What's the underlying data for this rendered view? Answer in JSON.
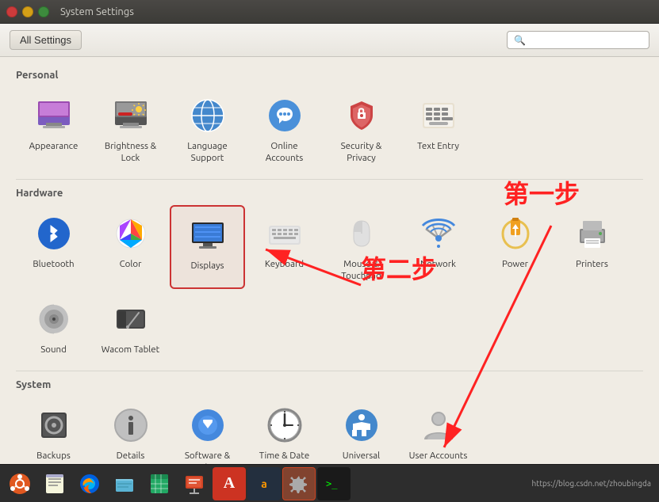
{
  "titlebar": {
    "title": "System Settings"
  },
  "toolbar": {
    "all_settings_label": "All Settings",
    "search_placeholder": ""
  },
  "sections": [
    {
      "name": "Personal",
      "items": [
        {
          "id": "appearance",
          "label": "Appearance",
          "icon": "appearance"
        },
        {
          "id": "brightness-lock",
          "label": "Brightness &\nLock",
          "icon": "brightness"
        },
        {
          "id": "language-support",
          "label": "Language\nSupport",
          "icon": "language"
        },
        {
          "id": "online-accounts",
          "label": "Online\nAccounts",
          "icon": "online-accounts"
        },
        {
          "id": "security-privacy",
          "label": "Security &\nPrivacy",
          "icon": "security"
        },
        {
          "id": "text-entry",
          "label": "Text Entry",
          "icon": "text-entry"
        }
      ]
    },
    {
      "name": "Hardware",
      "items": [
        {
          "id": "bluetooth",
          "label": "Bluetooth",
          "icon": "bluetooth"
        },
        {
          "id": "color",
          "label": "Color",
          "icon": "color"
        },
        {
          "id": "displays",
          "label": "Displays",
          "icon": "displays",
          "selected": true
        },
        {
          "id": "keyboard",
          "label": "Keyboard",
          "icon": "keyboard"
        },
        {
          "id": "mouse-touchpad",
          "label": "Mouse &\nTouchpad",
          "icon": "mouse"
        },
        {
          "id": "network",
          "label": "Network",
          "icon": "network"
        },
        {
          "id": "power",
          "label": "Power",
          "icon": "power"
        },
        {
          "id": "printers",
          "label": "Printers",
          "icon": "printers"
        },
        {
          "id": "sound",
          "label": "Sound",
          "icon": "sound"
        },
        {
          "id": "wacom-tablet",
          "label": "Wacom Tablet",
          "icon": "wacom"
        }
      ]
    },
    {
      "name": "System",
      "items": [
        {
          "id": "backups",
          "label": "Backups",
          "icon": "backups"
        },
        {
          "id": "details",
          "label": "Details",
          "icon": "details"
        },
        {
          "id": "software-updates",
          "label": "Software &\nUpdates",
          "icon": "software"
        },
        {
          "id": "time-date",
          "label": "Time & Date",
          "icon": "time"
        },
        {
          "id": "universal-access",
          "label": "Universal\nAccess",
          "icon": "universal"
        },
        {
          "id": "user-accounts",
          "label": "User\nAccounts",
          "icon": "users"
        }
      ]
    }
  ],
  "annotations": {
    "step1": "第一步",
    "step2": "第二步"
  },
  "taskbar": {
    "url": "https://blog.csdn.net/zhoubingda",
    "icons": [
      {
        "id": "ubuntu",
        "label": "Ubuntu Logo"
      },
      {
        "id": "text-editor",
        "label": "Text Editor"
      },
      {
        "id": "firefox",
        "label": "Firefox"
      },
      {
        "id": "files",
        "label": "Files"
      },
      {
        "id": "spreadsheet",
        "label": "Spreadsheet"
      },
      {
        "id": "presentation",
        "label": "Presentation"
      },
      {
        "id": "font",
        "label": "Font App"
      },
      {
        "id": "amazon",
        "label": "Amazon"
      },
      {
        "id": "settings",
        "label": "System Settings",
        "active": true
      },
      {
        "id": "terminal",
        "label": "Terminal"
      }
    ]
  }
}
